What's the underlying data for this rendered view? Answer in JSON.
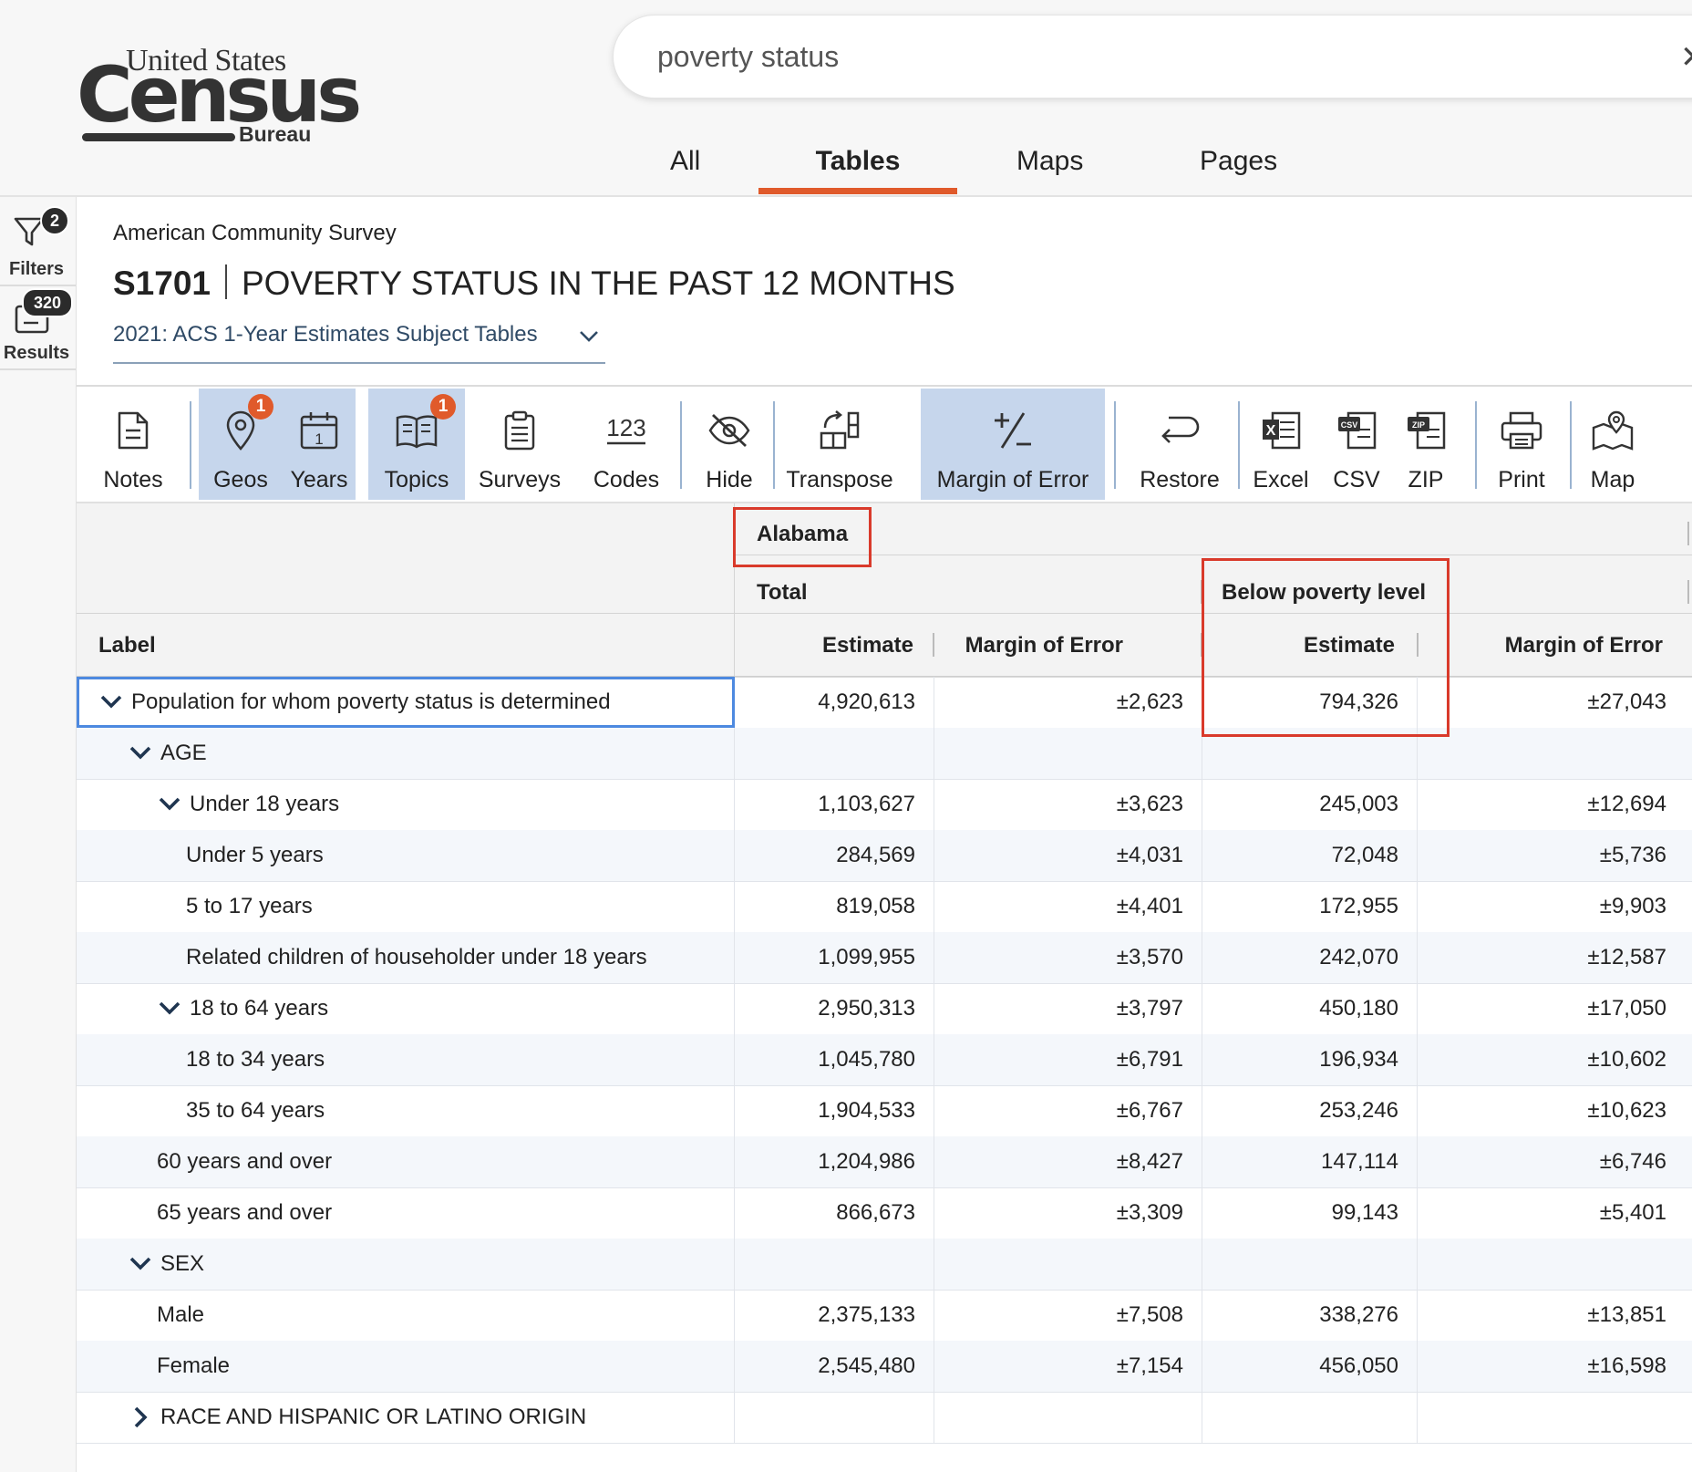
{
  "logo": {
    "line1": "United States",
    "line2": "Census",
    "line3": "Bureau"
  },
  "search": {
    "value": "poverty status"
  },
  "search_tabs": [
    {
      "label": "All"
    },
    {
      "label": "Tables"
    },
    {
      "label": "Maps"
    },
    {
      "label": "Pages"
    }
  ],
  "rail": {
    "filters": {
      "label": "Filters",
      "count": "2"
    },
    "results": {
      "label": "Results",
      "count": "320"
    }
  },
  "page": {
    "survey": "American Community Survey",
    "table_code": "S1701",
    "table_title": "POVERTY STATUS IN THE PAST 12 MONTHS",
    "vintage": "2021: ACS 1-Year Estimates Subject Tables"
  },
  "toolbar": [
    {
      "label": "Notes",
      "icon": "notes-icon"
    },
    {
      "label": "Geos",
      "icon": "map-pin-icon",
      "badge": "1",
      "active": true
    },
    {
      "label": "Years",
      "icon": "calendar-icon",
      "active": true
    },
    {
      "label": "Topics",
      "icon": "book-icon",
      "badge": "1",
      "active": true
    },
    {
      "label": "Surveys",
      "icon": "clipboard-icon"
    },
    {
      "label": "Codes",
      "icon": "codes-icon"
    },
    {
      "label": "Hide",
      "icon": "eye-off-icon"
    },
    {
      "label": "Transpose",
      "icon": "transpose-icon"
    },
    {
      "label": "Margin of Error",
      "icon": "plus-minus-icon",
      "active": true
    },
    {
      "label": "Restore",
      "icon": "restore-icon"
    },
    {
      "label": "Excel",
      "icon": "excel-icon"
    },
    {
      "label": "CSV",
      "icon": "csv-icon"
    },
    {
      "label": "ZIP",
      "icon": "zip-icon"
    },
    {
      "label": "Print",
      "icon": "printer-icon"
    },
    {
      "label": "Map",
      "icon": "map-icon"
    }
  ],
  "table": {
    "geo": "Alabama",
    "groups": [
      "Total",
      "Below poverty level"
    ],
    "columns": [
      "Label",
      "Estimate",
      "Margin of Error",
      "Estimate",
      "Margin of Error"
    ],
    "rows": [
      {
        "label": "Population for whom poverty status is determined",
        "chevron": "down",
        "values": [
          "4,920,613",
          "±2,623",
          "794,326",
          "±27,043"
        ]
      },
      {
        "label": "AGE",
        "chevron": "down",
        "values": [
          "",
          "",
          "",
          ""
        ]
      },
      {
        "label": "Under 18 years",
        "chevron": "down",
        "values": [
          "1,103,627",
          "±3,623",
          "245,003",
          "±12,694"
        ]
      },
      {
        "label": "Under 5 years",
        "values": [
          "284,569",
          "±4,031",
          "72,048",
          "±5,736"
        ]
      },
      {
        "label": "5 to 17 years",
        "values": [
          "819,058",
          "±4,401",
          "172,955",
          "±9,903"
        ]
      },
      {
        "label": "Related children of householder under 18 years",
        "values": [
          "1,099,955",
          "±3,570",
          "242,070",
          "±12,587"
        ]
      },
      {
        "label": "18 to 64 years",
        "chevron": "down",
        "values": [
          "2,950,313",
          "±3,797",
          "450,180",
          "±17,050"
        ]
      },
      {
        "label": "18 to 34 years",
        "values": [
          "1,045,780",
          "±6,791",
          "196,934",
          "±10,602"
        ]
      },
      {
        "label": "35 to 64 years",
        "values": [
          "1,904,533",
          "±6,767",
          "253,246",
          "±10,623"
        ]
      },
      {
        "label": "60 years and over",
        "values": [
          "1,204,986",
          "±8,427",
          "147,114",
          "±6,746"
        ]
      },
      {
        "label": "65 years and over",
        "values": [
          "866,673",
          "±3,309",
          "99,143",
          "±5,401"
        ]
      },
      {
        "label": "SEX",
        "chevron": "down",
        "values": [
          "",
          "",
          "",
          ""
        ]
      },
      {
        "label": "Male",
        "values": [
          "2,375,133",
          "±7,508",
          "338,276",
          "±13,851"
        ]
      },
      {
        "label": "Female",
        "values": [
          "2,545,480",
          "±7,154",
          "456,050",
          "±16,598"
        ]
      },
      {
        "label": "RACE AND HISPANIC OR LATINO ORIGIN",
        "chevron": "right",
        "values": [
          "",
          "",
          "",
          ""
        ]
      }
    ]
  },
  "colors": {
    "accent": "#e05a2b",
    "highlight_box": "#d93a2b",
    "active_tool": "#c6d6ec",
    "focus": "#4d89e0"
  }
}
